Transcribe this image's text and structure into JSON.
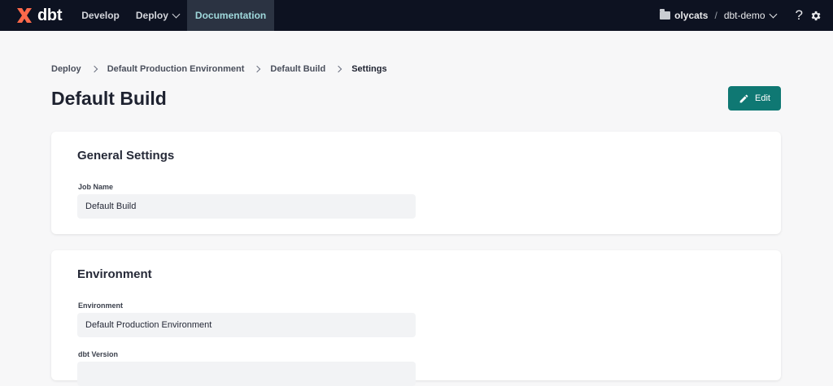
{
  "nav": {
    "logo_text": "dbt",
    "items": [
      {
        "label": "Develop"
      },
      {
        "label": "Deploy"
      },
      {
        "label": "Documentation"
      }
    ],
    "account": "olycats",
    "separator": "/",
    "project": "dbt-demo",
    "help_glyph": "?"
  },
  "breadcrumb": [
    "Deploy",
    "Default Production Environment",
    "Default Build",
    "Settings"
  ],
  "page": {
    "title": "Default Build",
    "edit_label": "Edit"
  },
  "general": {
    "heading": "General Settings",
    "job_name_label": "Job Name",
    "job_name_value": "Default Build"
  },
  "environment": {
    "heading": "Environment",
    "env_label": "Environment",
    "env_value": "Default Production Environment",
    "version_label": "dbt Version"
  },
  "colors": {
    "nav_bg": "#0d1221",
    "accent": "#0f7873",
    "logo": "#ff694a"
  }
}
